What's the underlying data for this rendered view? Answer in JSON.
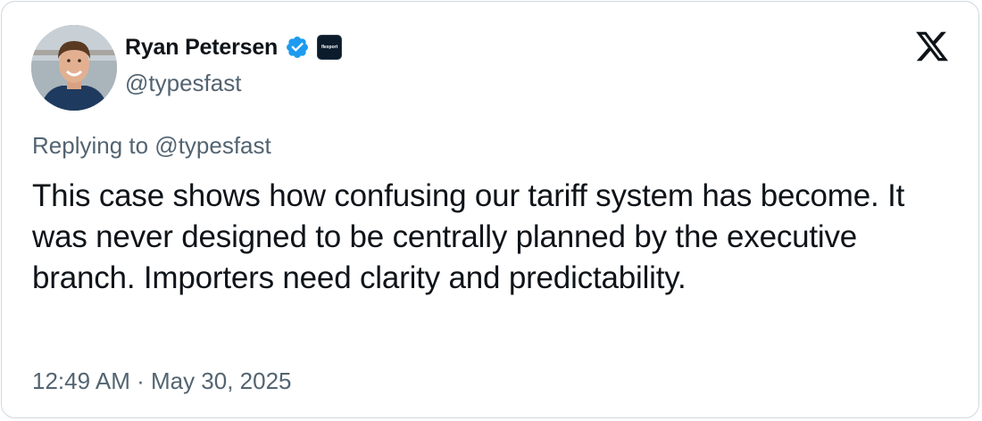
{
  "author": {
    "name": "Ryan Petersen",
    "handle": "@typesfast",
    "affiliate_badge": "flexport"
  },
  "reply": {
    "prefix": "Replying to",
    "to": "@typesfast",
    "full": "Replying to @typesfast"
  },
  "tweet": {
    "text": "This case shows how confusing our tariff system has become. It was never designed to be centrally planned by the executive branch. Importers need clarity and predictability.",
    "timestamp": "12:49 AM · May 30, 2025"
  },
  "colors": {
    "verified": "#1d9bf0",
    "text_primary": "#0f1419",
    "text_secondary": "#536471",
    "border": "#cfd9de"
  },
  "icons": {
    "verified": "verified-badge-icon",
    "brand": "x-logo-icon",
    "affiliate": "affiliate-badge-icon"
  }
}
